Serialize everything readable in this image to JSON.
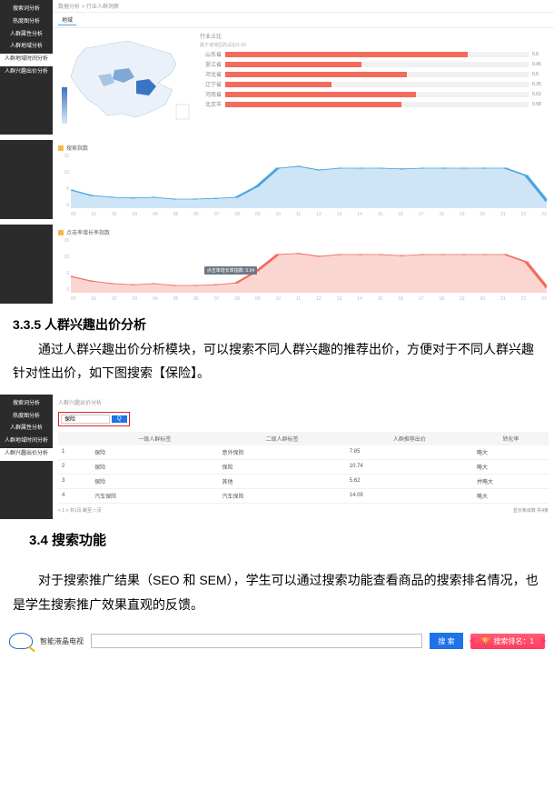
{
  "panel1": {
    "breadcrumb": "数据分析 > 行业人群洞察",
    "tab_map": "地域",
    "sidebar": [
      "搜索词分析",
      "热度图分析",
      "人群属性分析",
      "人群地域分析",
      "人群地域时间分析",
      "人群兴趣出价分析"
    ],
    "rank_title": "行业占比",
    "rank_sub": "属于该地区的占比/1.00",
    "bars": [
      {
        "name": "山东省",
        "v": 0.8
      },
      {
        "name": "浙江省",
        "v": 0.45
      },
      {
        "name": "河北省",
        "v": 0.6
      },
      {
        "name": "辽宁省",
        "v": 0.35
      },
      {
        "name": "河南省",
        "v": 0.63
      },
      {
        "name": "北京市",
        "v": 0.58
      }
    ]
  },
  "panel2": {
    "title": "搜索指数"
  },
  "panel3": {
    "title": "点击率增长率指数",
    "tooltip": "点击率增长率指数: 5.94"
  },
  "chart_data": [
    {
      "type": "area",
      "title": "搜索指数",
      "ylim": [
        0,
        15
      ],
      "yticks": [
        0,
        5,
        10,
        15
      ],
      "x": [
        0,
        1,
        2,
        3,
        4,
        5,
        6,
        7,
        8,
        9,
        10,
        11,
        12,
        13,
        14,
        15,
        16,
        17,
        18,
        19,
        20,
        21,
        22,
        23
      ],
      "color": "#4aa3df",
      "series": [
        {
          "name": "搜索指数",
          "values": [
            5,
            3.5,
            3,
            2.8,
            3,
            2.5,
            2.5,
            2.7,
            3,
            6,
            11,
            11.5,
            10.5,
            11,
            11,
            11,
            10.8,
            11,
            11,
            11,
            11,
            11,
            9,
            2
          ]
        }
      ]
    },
    {
      "type": "area",
      "title": "点击率增长率指数",
      "ylim": [
        0,
        15
      ],
      "yticks": [
        0,
        5,
        10,
        15
      ],
      "x": [
        0,
        1,
        2,
        3,
        4,
        5,
        6,
        7,
        8,
        9,
        10,
        11,
        12,
        13,
        14,
        15,
        16,
        17,
        18,
        19,
        20,
        21,
        22,
        23
      ],
      "color": "#f26b5b",
      "series": [
        {
          "name": "点击率增长率指数",
          "values": [
            4.5,
            3.2,
            2.5,
            2.2,
            2.5,
            2,
            2,
            2.2,
            2.7,
            6,
            10.5,
            10.8,
            10,
            10.5,
            10.5,
            10.5,
            10.2,
            10.5,
            10.5,
            10.5,
            10.5,
            10.5,
            8.5,
            1.5
          ]
        }
      ]
    }
  ],
  "section335": {
    "heading": "3.3.5 人群兴趣出价分析",
    "p": "通过人群兴趣出价分析模块，可以搜索不同人群兴趣的推荐出价，方便对于不同人群兴趣针对性出价，如下图搜索【保险】。"
  },
  "table_panel": {
    "crumb": "人群兴趣出价分析",
    "sidebar": [
      "搜索词分析",
      "热度图分析",
      "人群属性分析",
      "人群地域时间分析",
      "人群兴趣出价分析"
    ],
    "search_value": "保险",
    "search_btn": "Q",
    "cols": [
      "",
      "一级人群标签",
      "二级人群标签",
      "人群推荐出价",
      "转化率"
    ],
    "rows": [
      [
        "1",
        "保险",
        "意外保险",
        "7.85",
        "略大"
      ],
      [
        "2",
        "保险",
        "保险",
        "10.74",
        "略大"
      ],
      [
        "3",
        "保险",
        "其他",
        "5.62",
        "并略大"
      ],
      [
        "4",
        "汽车保险",
        "汽车保险",
        "14.09",
        "略大"
      ]
    ],
    "pager_left": "< 1 > 共1页   跳至 □ 页",
    "pager_right": "显示条目数 共4条"
  },
  "section34": {
    "heading": "3.4 搜索功能",
    "p": "对于搜索推广结果（SEO 和 SEM），学生可以通过搜索功能查看商品的搜索排名情况，也是学生搜索推广效果直观的反馈。"
  },
  "search_fig": {
    "product": "智能液晶电视",
    "btn": "搜 索",
    "ribbon": "搜索排名：1"
  }
}
